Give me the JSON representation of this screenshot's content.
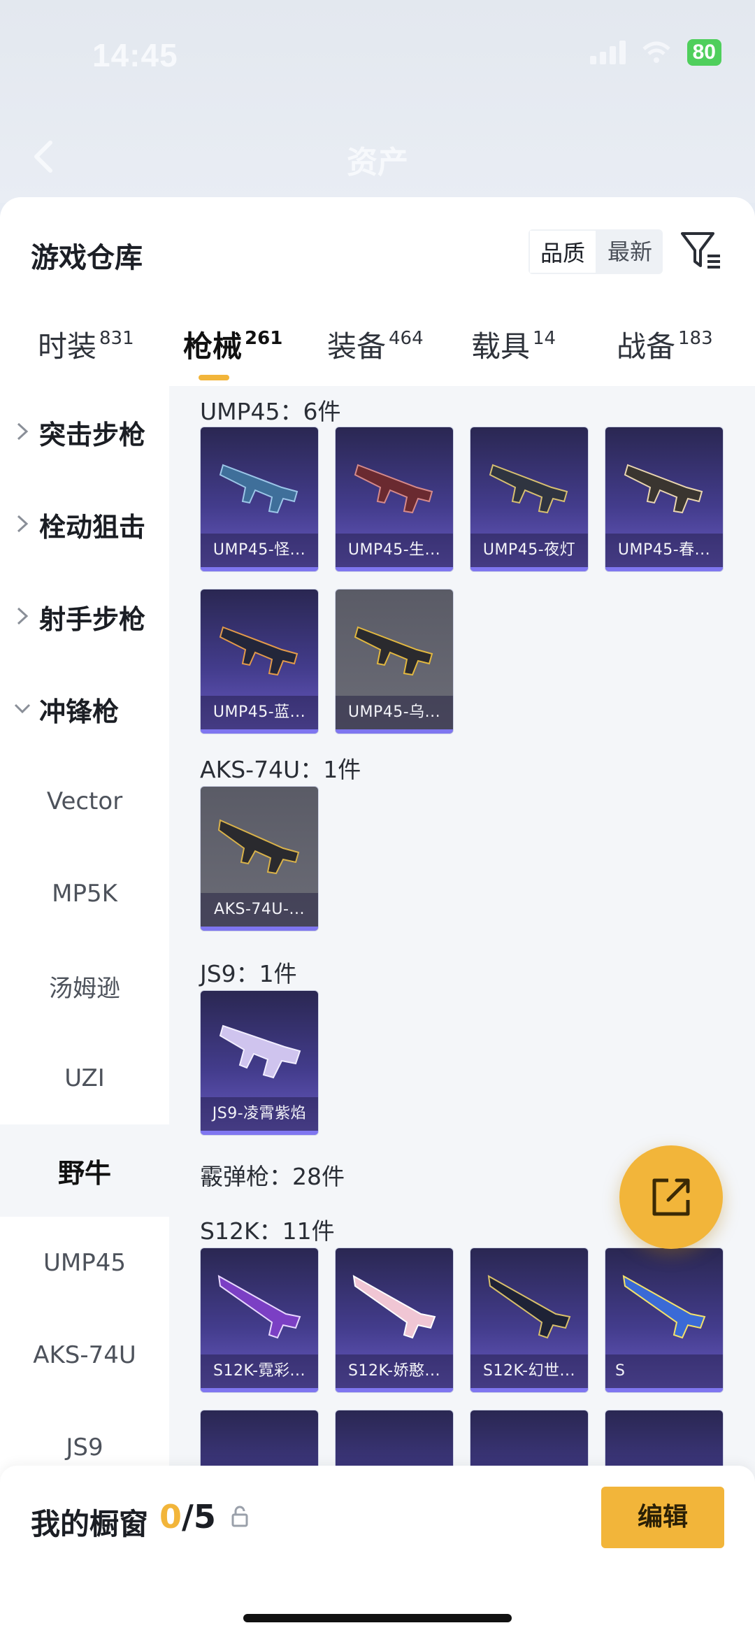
{
  "status_bar": {
    "time": "14:45",
    "battery": "80"
  },
  "header": {
    "title": "资产"
  },
  "warehouse": {
    "title": "游戏仓库",
    "sort": {
      "quality": "品质",
      "latest": "最新"
    }
  },
  "tabs": [
    {
      "label": "时装",
      "count": "831"
    },
    {
      "label": "枪械",
      "count": "261"
    },
    {
      "label": "装备",
      "count": "464"
    },
    {
      "label": "载具",
      "count": "14"
    },
    {
      "label": "战备",
      "count": "183"
    }
  ],
  "sidebar": {
    "categories": [
      "突击步枪",
      "栓动狙击",
      "射手步枪",
      "冲锋枪"
    ],
    "subs": [
      "Vector",
      "MP5K",
      "汤姆逊",
      "UZI",
      "野牛",
      "UMP45",
      "AKS-74U",
      "JS9"
    ]
  },
  "groups": {
    "ump45": {
      "title": "UMP45：6件",
      "items": [
        "UMP45-怪...",
        "UMP45-生...",
        "UMP45-夜灯",
        "UMP45-春...",
        "UMP45-蓝...",
        "UMP45-乌..."
      ]
    },
    "aks": {
      "title": "AKS-74U：1件",
      "items": [
        "AKS-74U-..."
      ]
    },
    "js9": {
      "title": "JS9：1件",
      "items": [
        "JS9-凌霄紫焰"
      ]
    },
    "shotgun": {
      "title": "霰弹枪：28件"
    },
    "s12k": {
      "title": "S12K：11件",
      "items": [
        "S12K-霓彩...",
        "S12K-娇憨...",
        "S12K-幻世...",
        "S"
      ]
    }
  },
  "showcase": {
    "label": "我的橱窗",
    "current": "0",
    "total": "/5",
    "edit": "编辑"
  },
  "colors": {
    "accent": "#f2b53a",
    "card_purple": "#433c8c",
    "card_gray": "#6c6d77"
  }
}
